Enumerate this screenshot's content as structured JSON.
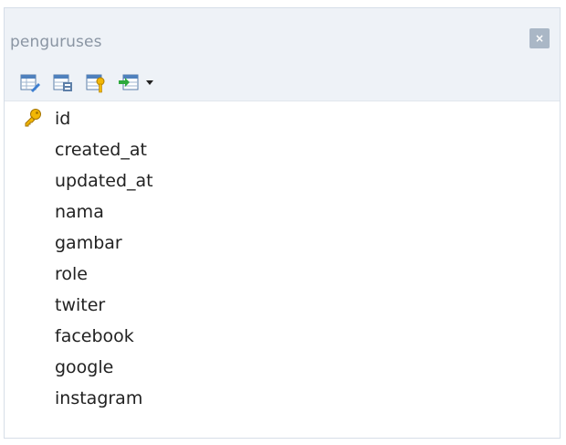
{
  "window": {
    "title": "penguruses",
    "close_label": "×"
  },
  "toolbar": {
    "buttons": [
      {
        "icon": "edit-table-icon"
      },
      {
        "icon": "table-properties-icon"
      },
      {
        "icon": "primary-key-icon"
      },
      {
        "icon": "import-export-icon"
      }
    ]
  },
  "fields": [
    {
      "name": "id",
      "primary_key": true
    },
    {
      "name": "created_at"
    },
    {
      "name": "updated_at"
    },
    {
      "name": "nama"
    },
    {
      "name": "gambar"
    },
    {
      "name": "role"
    },
    {
      "name": "twiter"
    },
    {
      "name": "facebook"
    },
    {
      "name": "google"
    },
    {
      "name": "instagram"
    }
  ],
  "colors": {
    "header_bg": "#eef2f7",
    "title_text": "#8a95a3",
    "close_bg": "#aab7c6",
    "key_gold": "#e0a400"
  }
}
